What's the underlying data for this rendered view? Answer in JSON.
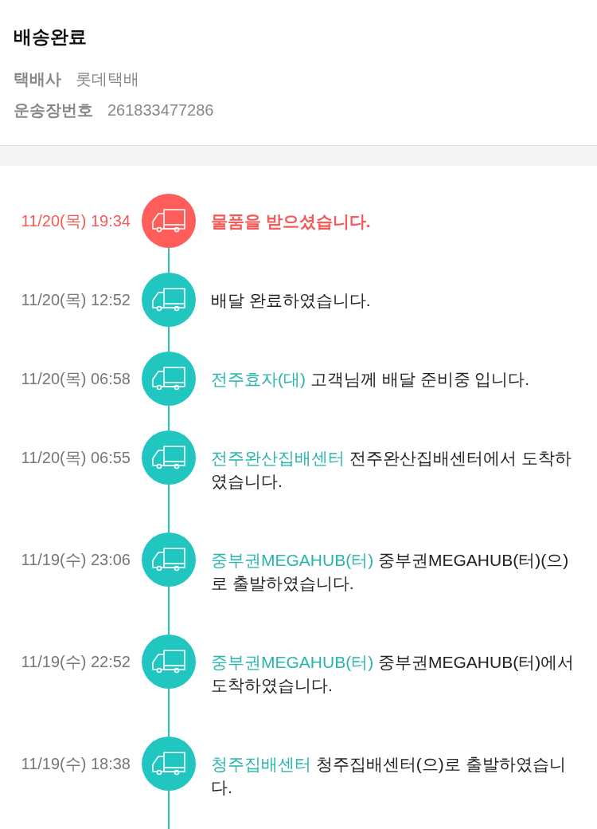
{
  "header": {
    "title": "배송완료",
    "fields": [
      {
        "label": "택배사",
        "value": "롯데택배"
      },
      {
        "label": "운송장번호",
        "value": "261833477286"
      }
    ]
  },
  "events": [
    {
      "time": "11/20(목) 19:34",
      "latest": true,
      "message": "물품을 받으셨습니다."
    },
    {
      "time": "11/20(목) 12:52",
      "latest": false,
      "message": "배달 완료하였습니다."
    },
    {
      "time": "11/20(목) 06:58",
      "latest": false,
      "location": "전주효자(대)",
      "message": "고객님께 배달 준비중 입니다."
    },
    {
      "time": "11/20(목) 06:55",
      "latest": false,
      "location": "전주완산집배센터",
      "message": "전주완산집배센터에서 도착하였습니다."
    },
    {
      "time": "11/19(수) 23:06",
      "latest": false,
      "location": "중부권MEGAHUB(터)",
      "message": "중부권MEGAHUB(터)(으)로 출발하였습니다."
    },
    {
      "time": "11/19(수) 22:52",
      "latest": false,
      "location": "중부권MEGAHUB(터)",
      "message": "중부권MEGAHUB(터)에서 도착하였습니다."
    },
    {
      "time": "11/19(수) 18:38",
      "latest": false,
      "location": "청주집배센터",
      "message": "청주집배센터(으)로 출발하였습니다."
    }
  ]
}
